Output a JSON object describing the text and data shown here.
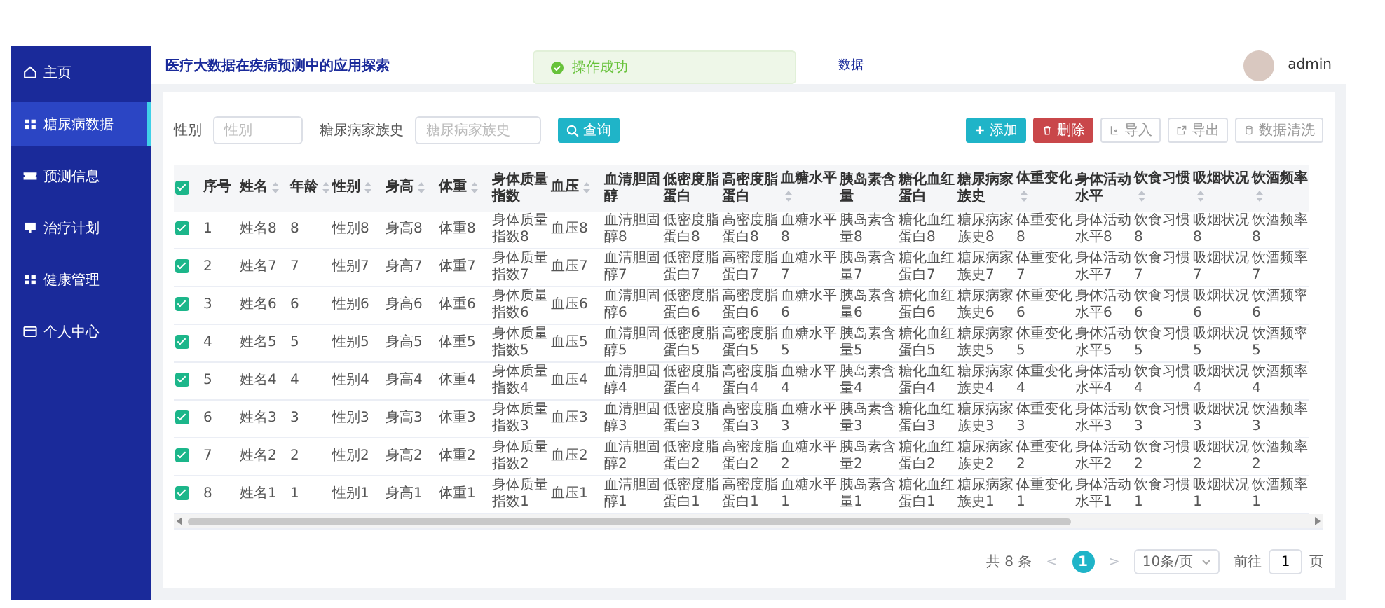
{
  "sidebar": {
    "items": [
      {
        "label": "主页",
        "selected": false
      },
      {
        "label": "糖尿病数据",
        "selected": true
      },
      {
        "label": "预测信息",
        "selected": false
      },
      {
        "label": "治疗计划",
        "selected": false
      },
      {
        "label": "健康管理",
        "selected": false
      },
      {
        "label": "个人中心",
        "selected": false
      }
    ]
  },
  "header": {
    "title": "医疗大数据在疾病预测中的应用探索",
    "breadcrumb": "数据",
    "user": "admin"
  },
  "toast": {
    "kind": "success",
    "message": "操作成功"
  },
  "filters": [
    {
      "label": "性别",
      "placeholder": "性别"
    },
    {
      "label": "糖尿病家族史",
      "placeholder": "糖尿病家族史"
    }
  ],
  "search_button": "查询",
  "actions": [
    {
      "label": "添加",
      "kind": "primary"
    },
    {
      "label": "删除",
      "kind": "danger"
    },
    {
      "label": "导入",
      "kind": "plain"
    },
    {
      "label": "导出",
      "kind": "plain"
    },
    {
      "label": "数据清洗",
      "kind": "plain"
    }
  ],
  "table": {
    "all_checked": true,
    "columns": [
      {
        "label": "序号",
        "sortable": false
      },
      {
        "label": "姓名",
        "sortable": true
      },
      {
        "label": "年龄",
        "sortable": true
      },
      {
        "label": "性别",
        "sortable": true
      },
      {
        "label": "身高",
        "sortable": true
      },
      {
        "label": "体重",
        "sortable": true
      },
      {
        "label": "身体质量指数",
        "sortable": false
      },
      {
        "label": "血压",
        "sortable": true
      },
      {
        "label": "血清胆固醇",
        "sortable": false
      },
      {
        "label": "低密度脂蛋白",
        "sortable": false
      },
      {
        "label": "高密度脂蛋白",
        "sortable": false
      },
      {
        "label": "血糖水平",
        "sortable": true
      },
      {
        "label": "胰岛素含量",
        "sortable": false
      },
      {
        "label": "糖化血红蛋白",
        "sortable": false
      },
      {
        "label": "糖尿病家族史",
        "sortable": false
      },
      {
        "label": "体重变化",
        "sortable": true
      },
      {
        "label": "身体活动水平",
        "sortable": false
      },
      {
        "label": "饮食习惯",
        "sortable": true
      },
      {
        "label": "吸烟状况",
        "sortable": true
      },
      {
        "label": "饮酒频率",
        "sortable": true
      }
    ],
    "rows": [
      {
        "checked": true,
        "cells": [
          "1",
          "姓名8",
          "8",
          "性别8",
          "身高8",
          "体重8",
          "身体质量指数8",
          "血压8",
          "血清胆固醇8",
          "低密度脂蛋白8",
          "高密度脂蛋白8",
          "血糖水平8",
          "胰岛素含量8",
          "糖化血红蛋白8",
          "糖尿病家族史8",
          "体重变化8",
          "身体活动水平8",
          "饮食习惯8",
          "吸烟状况8",
          "饮酒频率8"
        ]
      },
      {
        "checked": true,
        "cells": [
          "2",
          "姓名7",
          "7",
          "性别7",
          "身高7",
          "体重7",
          "身体质量指数7",
          "血压7",
          "血清胆固醇7",
          "低密度脂蛋白7",
          "高密度脂蛋白7",
          "血糖水平7",
          "胰岛素含量7",
          "糖化血红蛋白7",
          "糖尿病家族史7",
          "体重变化7",
          "身体活动水平7",
          "饮食习惯7",
          "吸烟状况7",
          "饮酒频率7"
        ]
      },
      {
        "checked": true,
        "cells": [
          "3",
          "姓名6",
          "6",
          "性别6",
          "身高6",
          "体重6",
          "身体质量指数6",
          "血压6",
          "血清胆固醇6",
          "低密度脂蛋白6",
          "高密度脂蛋白6",
          "血糖水平6",
          "胰岛素含量6",
          "糖化血红蛋白6",
          "糖尿病家族史6",
          "体重变化6",
          "身体活动水平6",
          "饮食习惯6",
          "吸烟状况6",
          "饮酒频率6"
        ]
      },
      {
        "checked": true,
        "cells": [
          "4",
          "姓名5",
          "5",
          "性别5",
          "身高5",
          "体重5",
          "身体质量指数5",
          "血压5",
          "血清胆固醇5",
          "低密度脂蛋白5",
          "高密度脂蛋白5",
          "血糖水平5",
          "胰岛素含量5",
          "糖化血红蛋白5",
          "糖尿病家族史5",
          "体重变化5",
          "身体活动水平5",
          "饮食习惯5",
          "吸烟状况5",
          "饮酒频率5"
        ]
      },
      {
        "checked": true,
        "cells": [
          "5",
          "姓名4",
          "4",
          "性别4",
          "身高4",
          "体重4",
          "身体质量指数4",
          "血压4",
          "血清胆固醇4",
          "低密度脂蛋白4",
          "高密度脂蛋白4",
          "血糖水平4",
          "胰岛素含量4",
          "糖化血红蛋白4",
          "糖尿病家族史4",
          "体重变化4",
          "身体活动水平4",
          "饮食习惯4",
          "吸烟状况4",
          "饮酒频率4"
        ]
      },
      {
        "checked": true,
        "cells": [
          "6",
          "姓名3",
          "3",
          "性别3",
          "身高3",
          "体重3",
          "身体质量指数3",
          "血压3",
          "血清胆固醇3",
          "低密度脂蛋白3",
          "高密度脂蛋白3",
          "血糖水平3",
          "胰岛素含量3",
          "糖化血红蛋白3",
          "糖尿病家族史3",
          "体重变化3",
          "身体活动水平3",
          "饮食习惯3",
          "吸烟状况3",
          "饮酒频率3"
        ]
      },
      {
        "checked": true,
        "cells": [
          "7",
          "姓名2",
          "2",
          "性别2",
          "身高2",
          "体重2",
          "身体质量指数2",
          "血压2",
          "血清胆固醇2",
          "低密度脂蛋白2",
          "高密度脂蛋白2",
          "血糖水平2",
          "胰岛素含量2",
          "糖化血红蛋白2",
          "糖尿病家族史2",
          "体重变化2",
          "身体活动水平2",
          "饮食习惯2",
          "吸烟状况2",
          "饮酒频率2"
        ]
      },
      {
        "checked": true,
        "cells": [
          "8",
          "姓名1",
          "1",
          "性别1",
          "身高1",
          "体重1",
          "身体质量指数1",
          "血压1",
          "血清胆固醇1",
          "低密度脂蛋白1",
          "高密度脂蛋白1",
          "血糖水平1",
          "胰岛素含量1",
          "糖化血红蛋白1",
          "糖尿病家族史1",
          "体重变化1",
          "身体活动水平1",
          "饮食习惯1",
          "吸烟状况1",
          "饮酒频率1"
        ]
      }
    ]
  },
  "pagination": {
    "total": "共 8 条",
    "prev": "<",
    "pages": [
      {
        "label": "1",
        "selected": true
      }
    ],
    "next": ">",
    "page_size": "10条/页",
    "goto_label": "前往",
    "goto_value": "1",
    "goto_suffix": "页"
  }
}
